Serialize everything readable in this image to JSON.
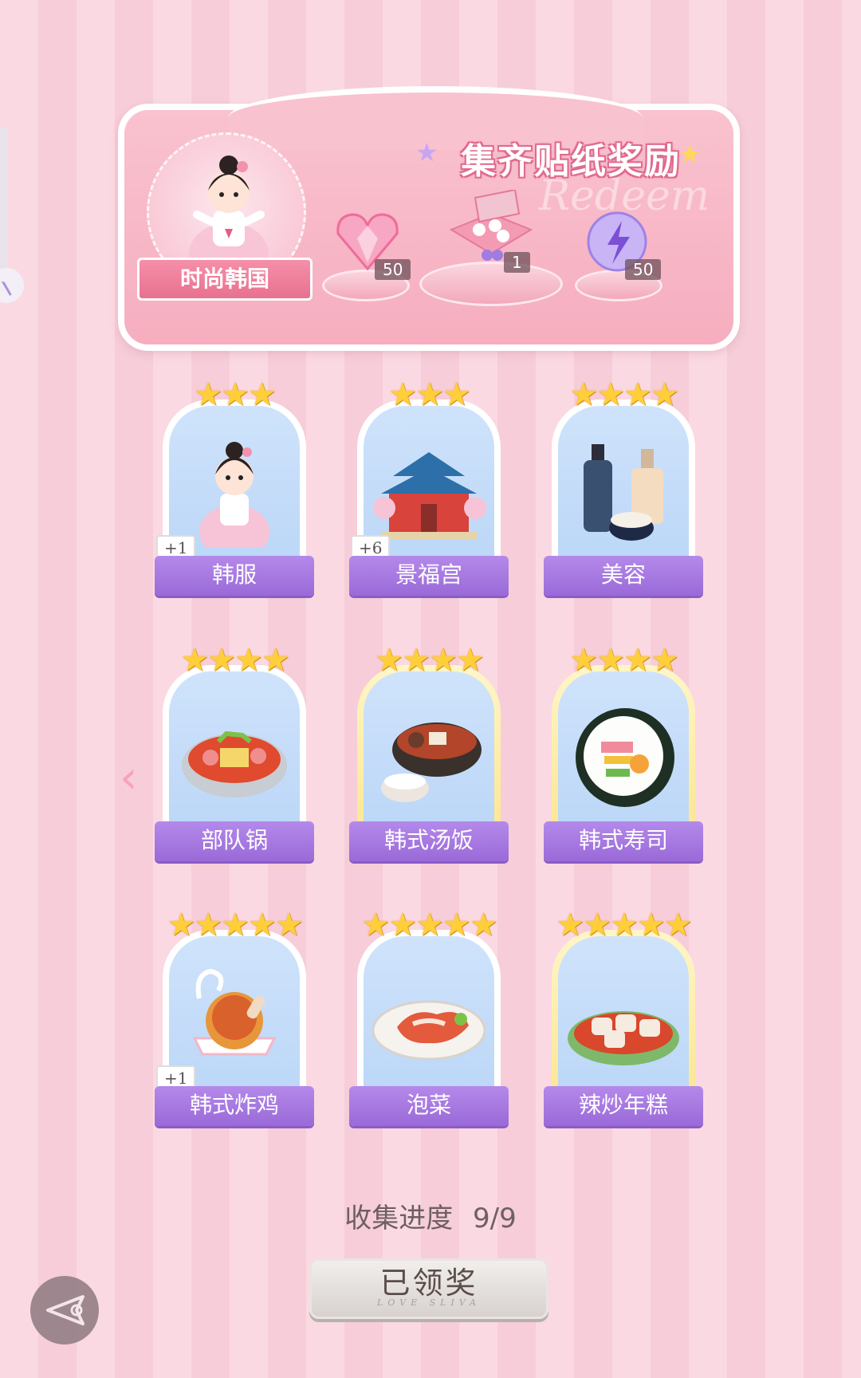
{
  "banner": {
    "title": "集齐贴纸奖励",
    "watermark": "Redeem",
    "theme_label": "时尚韩国",
    "rewards": [
      {
        "icon": "pink-heart-gem-icon",
        "count": "50"
      },
      {
        "icon": "gift-box-icon",
        "count": "1"
      },
      {
        "icon": "purple-lightning-orb-icon",
        "count": "50"
      }
    ]
  },
  "stickers": [
    {
      "label": "韩服",
      "stars": "★★★",
      "badge": "+1",
      "icon": "hanbok-girl-icon",
      "gold": false
    },
    {
      "label": "景福宫",
      "stars": "★★★",
      "badge": "+6",
      "icon": "palace-icon",
      "gold": false
    },
    {
      "label": "美容",
      "stars": "★★★★",
      "badge": "",
      "icon": "cosmetics-icon",
      "gold": false
    },
    {
      "label": "部队锅",
      "stars": "★★★★",
      "badge": "",
      "icon": "army-stew-icon",
      "gold": false
    },
    {
      "label": "韩式汤饭",
      "stars": "★★★★",
      "badge": "",
      "icon": "soup-rice-icon",
      "gold": true
    },
    {
      "label": "韩式寿司",
      "stars": "★★★★",
      "badge": "",
      "icon": "kimbap-icon",
      "gold": true
    },
    {
      "label": "韩式炸鸡",
      "stars": "★★★★★",
      "badge": "+1",
      "icon": "fried-chicken-icon",
      "gold": false
    },
    {
      "label": "泡菜",
      "stars": "★★★★★",
      "badge": "",
      "icon": "kimchi-icon",
      "gold": false
    },
    {
      "label": "辣炒年糕",
      "stars": "★★★★★",
      "badge": "",
      "icon": "tteokbokki-icon",
      "gold": true
    }
  ],
  "progress": {
    "label": "收集进度",
    "value": "9/9"
  },
  "claim_button": {
    "label": "已领奖",
    "sub": "LOVE SLIVA"
  },
  "colors": {
    "accent_purple": "#a57ae0",
    "banner_pink": "#f6aebf",
    "star_gold": "#ffcf3a"
  }
}
